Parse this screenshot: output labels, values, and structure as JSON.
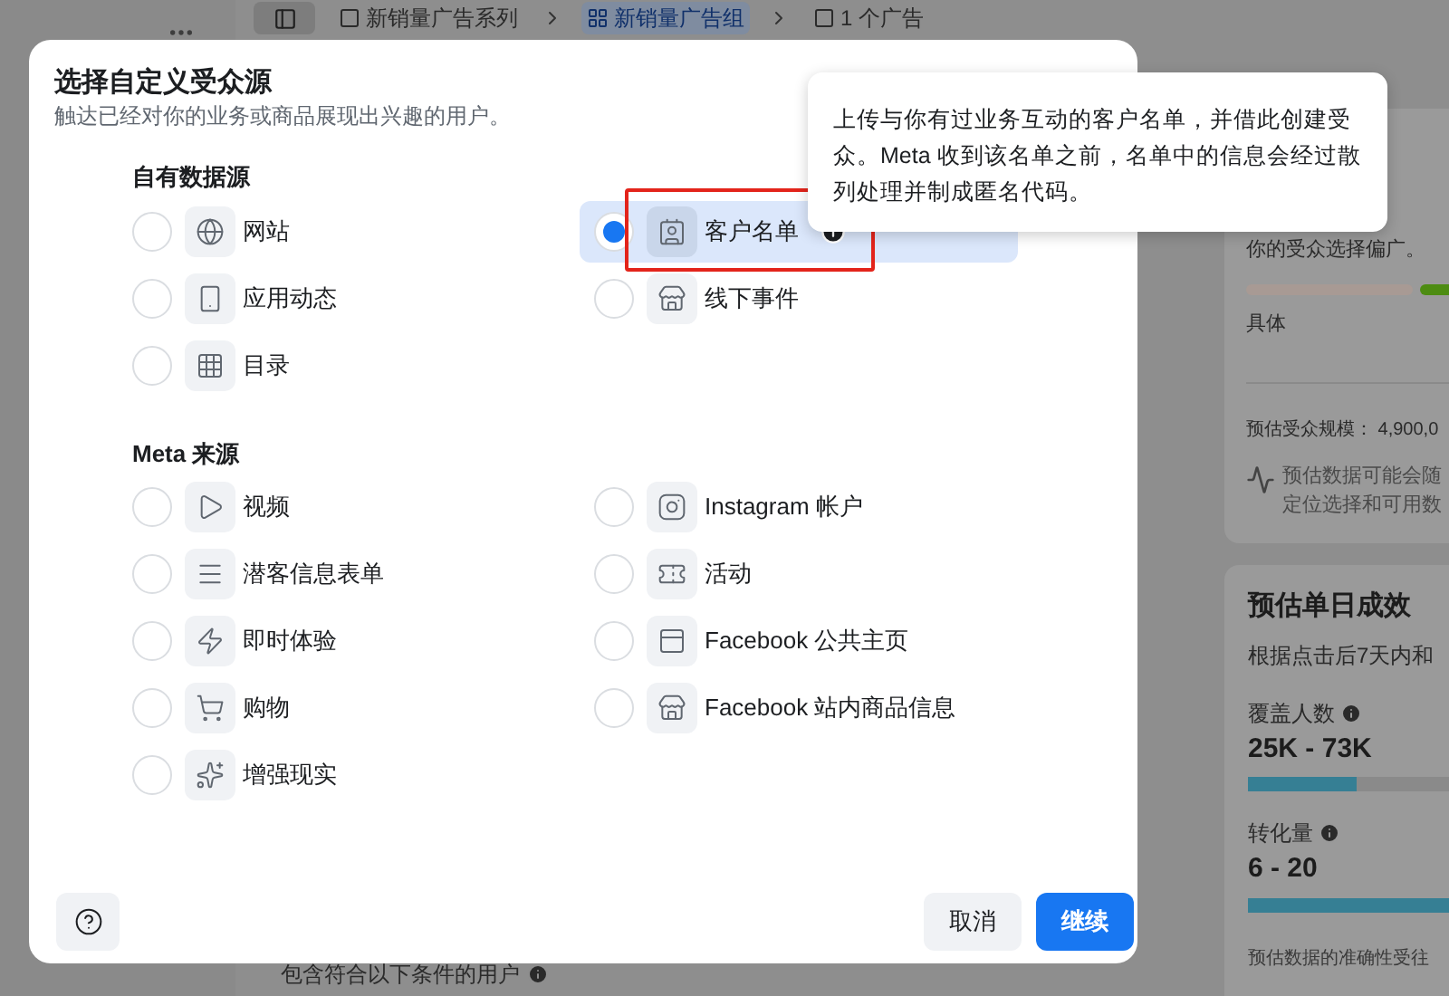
{
  "background": {
    "breadcrumbs": [
      {
        "label": "新销量广告系列",
        "selected": false
      },
      {
        "label": "新销量广告组",
        "selected": true
      },
      {
        "label": "1 个广告",
        "selected": false
      }
    ],
    "audience_card": {
      "note": "你的受众选择偏广。",
      "meter_label": "具体",
      "size": "预估受众规模： 4,900,0",
      "hint_lines": [
        "预估数据可能会随",
        "定位选择和可用数"
      ]
    },
    "results_card": {
      "title": "预估单日成效",
      "subtitle": "根据点击后7天内和",
      "metrics": [
        {
          "label": "覆盖人数",
          "value": "25K - 73K",
          "level": 0.54
        },
        {
          "label": "转化量",
          "value": "6 - 20",
          "level": 1
        }
      ],
      "footnote": "预估数据的准确性受往"
    },
    "footer_text": "包含符合以下条件的用户"
  },
  "dialog": {
    "title": "选择自定义受众源",
    "subtitle": "触达已经对你的业务或商品展现出兴趣的用户。",
    "sections": [
      {
        "heading": "自有数据源",
        "options": [
          {
            "label": "网站",
            "selected": false,
            "info": false,
            "highlighted": false
          },
          {
            "label": "客户名单",
            "selected": true,
            "info": true,
            "highlighted": true
          },
          {
            "label": "应用动态",
            "selected": false,
            "info": false,
            "highlighted": false
          },
          {
            "label": "线下事件",
            "selected": false,
            "info": false,
            "highlighted": false
          },
          {
            "label": "目录",
            "selected": false,
            "info": false,
            "highlighted": false
          }
        ]
      },
      {
        "heading": "Meta 来源",
        "options": [
          {
            "label": "视频",
            "selected": false,
            "info": false,
            "highlighted": false
          },
          {
            "label": "Instagram 帐户",
            "selected": false,
            "info": false,
            "highlighted": false
          },
          {
            "label": "潜客信息表单",
            "selected": false,
            "info": false,
            "highlighted": false
          },
          {
            "label": "活动",
            "selected": false,
            "info": false,
            "highlighted": false
          },
          {
            "label": "即时体验",
            "selected": false,
            "info": false,
            "highlighted": false
          },
          {
            "label": "Facebook 公共主页",
            "selected": false,
            "info": false,
            "highlighted": false
          },
          {
            "label": "购物",
            "selected": false,
            "info": false,
            "highlighted": false
          },
          {
            "label": "Facebook 站内商品信息",
            "selected": false,
            "info": false,
            "highlighted": false
          },
          {
            "label": "增强现实",
            "selected": false,
            "info": false,
            "highlighted": false
          }
        ]
      }
    ],
    "buttons": [
      {
        "label": "取消",
        "kind": "secondary"
      },
      {
        "label": "继续",
        "kind": "primary"
      }
    ]
  },
  "tooltip": {
    "text": "上传与你有过业务互动的客户名单，并借此创建受众。Meta 收到该名单之前，名单中的信息会经过散列处理并制成匿名代码。"
  }
}
